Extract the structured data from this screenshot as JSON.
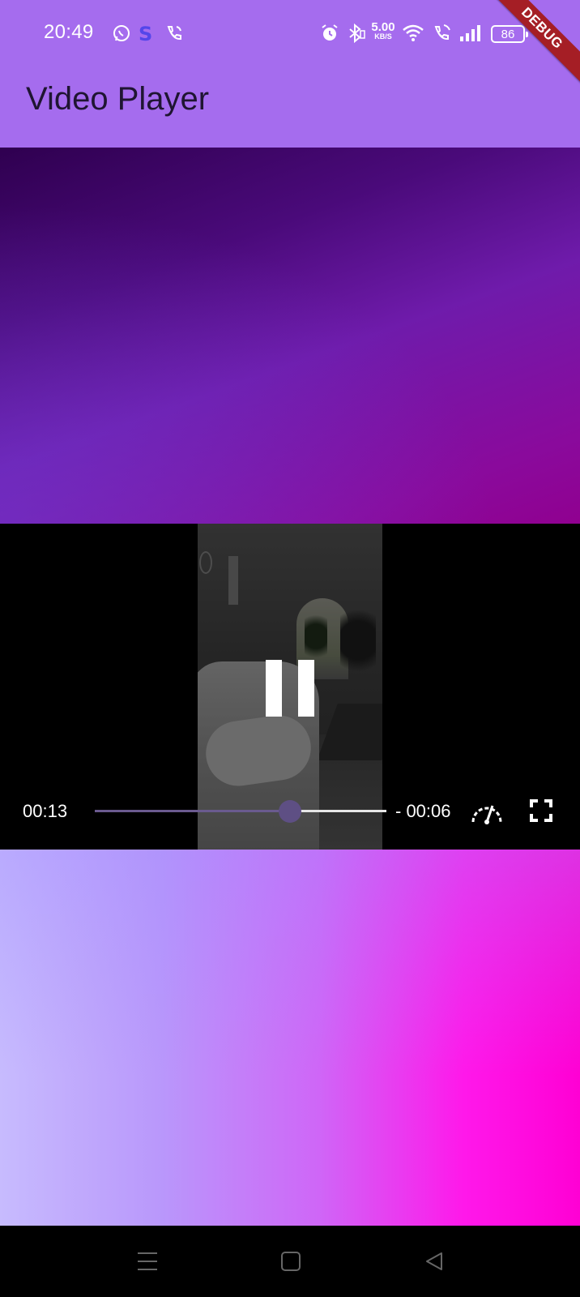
{
  "status_bar": {
    "time": "20:49",
    "network_speed_value": "5.00",
    "network_speed_unit": "KB/S",
    "battery_level": "86",
    "notification_icons": [
      "whatsapp-icon",
      "s-app-icon",
      "wifi-calling-icon"
    ],
    "system_icons": [
      "alarm-icon",
      "bluetooth-icon",
      "wifi-icon",
      "wifi-call-icon",
      "signal-icon",
      "battery-icon"
    ]
  },
  "app_bar": {
    "title": "Video Player",
    "color": "#a56cee"
  },
  "debug_banner": "DEBUG",
  "video": {
    "position_time": "00:13",
    "remaining_time": "- 00:06",
    "progress_fraction": 0.67,
    "state": "playing",
    "controls": [
      "pause-icon",
      "speed-icon",
      "fullscreen-icon"
    ]
  },
  "colors": {
    "debug_banner": "#a51e25",
    "seek_played": "#6a5a8f",
    "seek_thumb": "#5e4f84"
  },
  "nav_bar": {
    "buttons": [
      "menu-icon",
      "home-icon",
      "back-icon"
    ]
  }
}
